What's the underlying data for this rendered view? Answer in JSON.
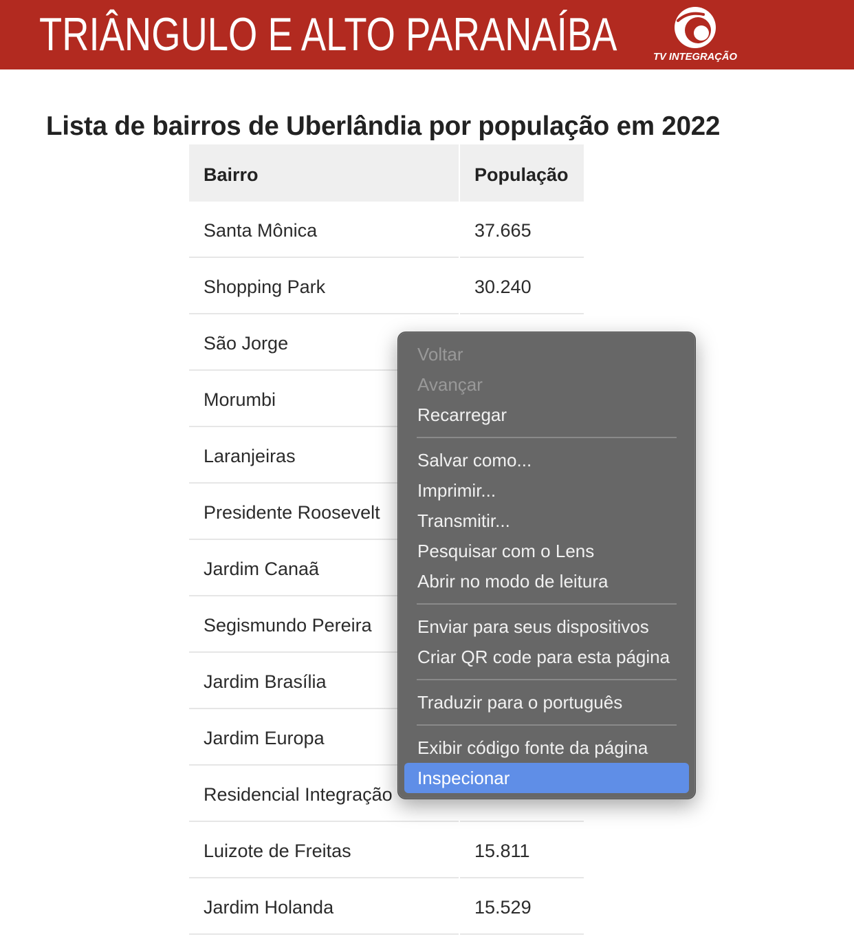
{
  "colors": {
    "accent_red": "#b22a20",
    "table_header_background": "#efefef",
    "menu_background": "#676767",
    "menu_highlight": "#5f8ee7"
  },
  "banner": {
    "title": "TRIÂNGULO E ALTO PARANAÍBA",
    "logo_icon": "tv-integracao-logo",
    "logo_text": "TV INTEGRAÇÃO"
  },
  "article": {
    "heading": "Lista de bairros de Uberlândia por população em 2022"
  },
  "table": {
    "columns": {
      "bairro": "Bairro",
      "populacao": "População"
    },
    "rows": [
      {
        "bairro": "Santa Mônica",
        "populacao": "37.665"
      },
      {
        "bairro": "Shopping Park",
        "populacao": "30.240"
      },
      {
        "bairro": "São Jorge"
      },
      {
        "bairro": "Morumbi"
      },
      {
        "bairro": "Laranjeiras"
      },
      {
        "bairro": "Presidente Roosevelt"
      },
      {
        "bairro": "Jardim Canaã"
      },
      {
        "bairro": "Segismundo Pereira"
      },
      {
        "bairro": "Jardim Brasília"
      },
      {
        "bairro": "Jardim Europa"
      },
      {
        "bairro": "Residencial Integração"
      },
      {
        "bairro": "Luizote de Freitas",
        "populacao": "15.811"
      },
      {
        "bairro": "Jardim Holanda",
        "populacao": "15.529"
      }
    ]
  },
  "context_menu": {
    "groups": [
      [
        {
          "label": "Voltar",
          "enabled": false
        },
        {
          "label": "Avançar",
          "enabled": false
        },
        {
          "label": "Recarregar",
          "enabled": true
        }
      ],
      [
        {
          "label": "Salvar como...",
          "enabled": true
        },
        {
          "label": "Imprimir...",
          "enabled": true
        },
        {
          "label": "Transmitir...",
          "enabled": true
        },
        {
          "label": "Pesquisar com o Lens",
          "enabled": true
        },
        {
          "label": "Abrir no modo de leitura",
          "enabled": true
        }
      ],
      [
        {
          "label": "Enviar para seus dispositivos",
          "enabled": true
        },
        {
          "label": "Criar QR code para esta página",
          "enabled": true
        }
      ],
      [
        {
          "label": "Traduzir para o português",
          "enabled": true
        }
      ],
      [
        {
          "label": "Exibir código fonte da página",
          "enabled": true
        },
        {
          "label": "Inspecionar",
          "enabled": true,
          "highlighted": true
        }
      ]
    ]
  }
}
